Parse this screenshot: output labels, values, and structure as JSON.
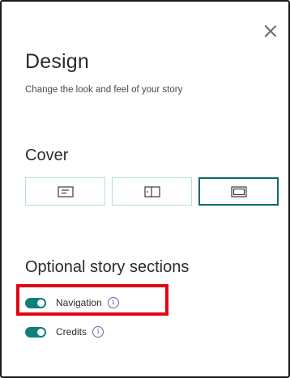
{
  "panel": {
    "title": "Design",
    "subtitle": "Change the look and feel of your story"
  },
  "cover": {
    "title": "Cover",
    "options": [
      {
        "icon": "minimal-layout-icon"
      },
      {
        "icon": "side-by-side-layout-icon"
      },
      {
        "icon": "full-layout-icon",
        "selected": true
      }
    ]
  },
  "sections": {
    "title": "Optional story sections",
    "items": [
      {
        "label": "Navigation",
        "enabled": true
      },
      {
        "label": "Credits",
        "enabled": true
      }
    ]
  },
  "colors": {
    "accent": "#0e7f7d",
    "highlight": "#e30613",
    "info": "#7a5aa8"
  }
}
